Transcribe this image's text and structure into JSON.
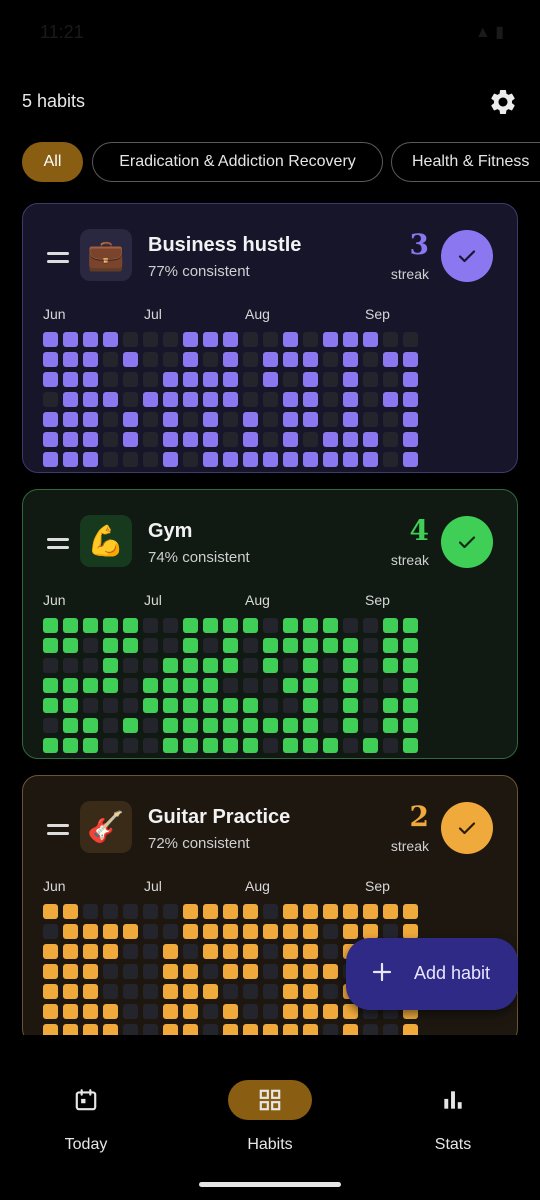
{
  "status_bar": {
    "time": "11:21",
    "icons": "signal-battery"
  },
  "header": {
    "habit_count": "5 habits",
    "settings_icon": "gear-icon"
  },
  "filters": [
    {
      "label": "All",
      "active": true
    },
    {
      "label": "Eradication & Addiction Recovery",
      "active": false
    },
    {
      "label": "Health & Fitness",
      "active": false
    }
  ],
  "months": [
    "Jun",
    "Jul",
    "Aug",
    "Sep"
  ],
  "habits": [
    {
      "name": "Business hustle",
      "emoji": "💼",
      "consistency": "77% consistent",
      "streak": "3",
      "streak_label": "streak",
      "completed_today": true,
      "color": "#8b78f0",
      "card_bg": "#17152a",
      "border": "#3e3a6e",
      "emoji_bg": "#2a2840",
      "pattern": [
        "1111000111001011100",
        "1110100101011101011",
        "1110001111010101001",
        "0111011111001101011",
        "1110101010101101001",
        "1110101110101011101",
        "1110001011111111101"
      ]
    },
    {
      "name": "Gym",
      "emoji": "💪",
      "consistency": "74% consistent",
      "streak": "4",
      "streak_label": "streak",
      "completed_today": true,
      "color": "#3fce56",
      "card_bg": "#101a13",
      "border": "#2e6a3a",
      "emoji_bg": "#173a1f",
      "pattern": [
        "1111100111101110011",
        "1101100101011111011",
        "0001001111010101011",
        "1111011110001101001",
        "1100011111100101011",
        "0110101111111101011",
        "1110001111101110101"
      ]
    },
    {
      "name": "Guitar Practice",
      "emoji": "🎸",
      "consistency": "72% consistent",
      "streak": "2",
      "streak_label": "streak",
      "completed_today": true,
      "color": "#f0aa3c",
      "card_bg": "#1d1710",
      "border": "#6a5530",
      "emoji_bg": "#3a2a18",
      "pattern": [
        "1100000111101111111",
        "0111100111111101101",
        "1111001011101101001",
        "1110001101101110001",
        "1110001110001101001",
        "1111001101001111001",
        "1111001101111101001"
      ]
    }
  ],
  "fab": {
    "label": "Add habit"
  },
  "nav": [
    {
      "label": "Today",
      "active": false
    },
    {
      "label": "Habits",
      "active": true
    },
    {
      "label": "Stats",
      "active": false
    }
  ]
}
